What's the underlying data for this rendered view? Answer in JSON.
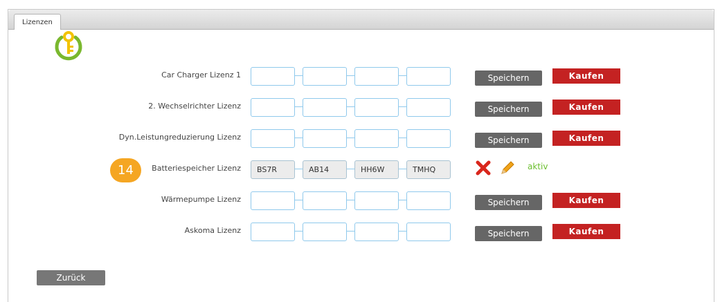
{
  "tabs": [
    {
      "label": "Lizenzen"
    }
  ],
  "icons": {
    "header": "key-power-icon",
    "delete": "close-icon",
    "edit": "pencil-icon"
  },
  "colors": {
    "accent_green": "#6bbe2e",
    "buy_red": "#c42222",
    "save_gray": "#666666",
    "field_border": "#8fc9ec",
    "badge_orange": "#f5a623"
  },
  "rows": [
    {
      "label": "Car Charger Lizenz 1",
      "fields": [
        "",
        "",
        "",
        ""
      ],
      "save": "Speichern",
      "buy": "Kaufen"
    },
    {
      "label": "2. Wechselrichter Lizenz",
      "fields": [
        "",
        "",
        "",
        ""
      ],
      "save": "Speichern",
      "buy": "Kaufen"
    },
    {
      "label": "Dyn.Leistungreduzierung Lizenz",
      "fields": [
        "",
        "",
        "",
        ""
      ],
      "save": "Speichern",
      "buy": "Kaufen"
    },
    {
      "label": "Batteriespeicher Lizenz",
      "fields": [
        "BS7R",
        "AB14",
        "HH6W",
        "TMHQ"
      ],
      "status": "aktiv",
      "badge": "14"
    },
    {
      "label": "Wärmepumpe Lizenz",
      "fields": [
        "",
        "",
        "",
        ""
      ],
      "save": "Speichern",
      "buy": "Kaufen"
    },
    {
      "label": "Askoma Lizenz",
      "fields": [
        "",
        "",
        "",
        ""
      ],
      "save": "Speichern",
      "buy": "Kaufen"
    }
  ],
  "footer": {
    "back_label": "Zurück"
  }
}
